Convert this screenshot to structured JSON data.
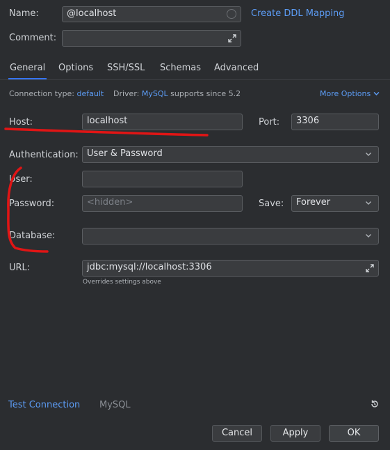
{
  "header": {
    "name_label": "Name:",
    "name_value": "@localhost",
    "ddl_link": "Create DDL Mapping",
    "comment_label": "Comment:",
    "comment_value": ""
  },
  "tabs": [
    {
      "label": "General"
    },
    {
      "label": "Options"
    },
    {
      "label": "SSH/SSL"
    },
    {
      "label": "Schemas"
    },
    {
      "label": "Advanced"
    }
  ],
  "info": {
    "conn_type_label": "Connection type:",
    "conn_type_value": "default",
    "driver_label": "Driver:",
    "driver_value": "MySQL",
    "driver_note": "supports since 5.2",
    "more_options": "More Options"
  },
  "form": {
    "host_label": "Host:",
    "host_value": "localhost",
    "port_label": "Port:",
    "port_value": "3306",
    "auth_label": "Authentication:",
    "auth_value": "User & Password",
    "user_label": "User:",
    "user_value": "",
    "password_label": "Password:",
    "password_placeholder": "<hidden>",
    "save_label": "Save:",
    "save_value": "Forever",
    "database_label": "Database:",
    "database_value": "",
    "url_label": "URL:",
    "url_value": "jdbc:mysql://localhost:3306",
    "url_hint": "Overrides settings above"
  },
  "footer": {
    "test_connection": "Test Connection",
    "driver_name": "MySQL",
    "cancel": "Cancel",
    "apply": "Apply",
    "ok": "OK"
  },
  "colors": {
    "background": "#2b2d30",
    "link": "#5c9cf5",
    "annotation_red": "#e01515",
    "tab_underline": "#3574f0"
  }
}
